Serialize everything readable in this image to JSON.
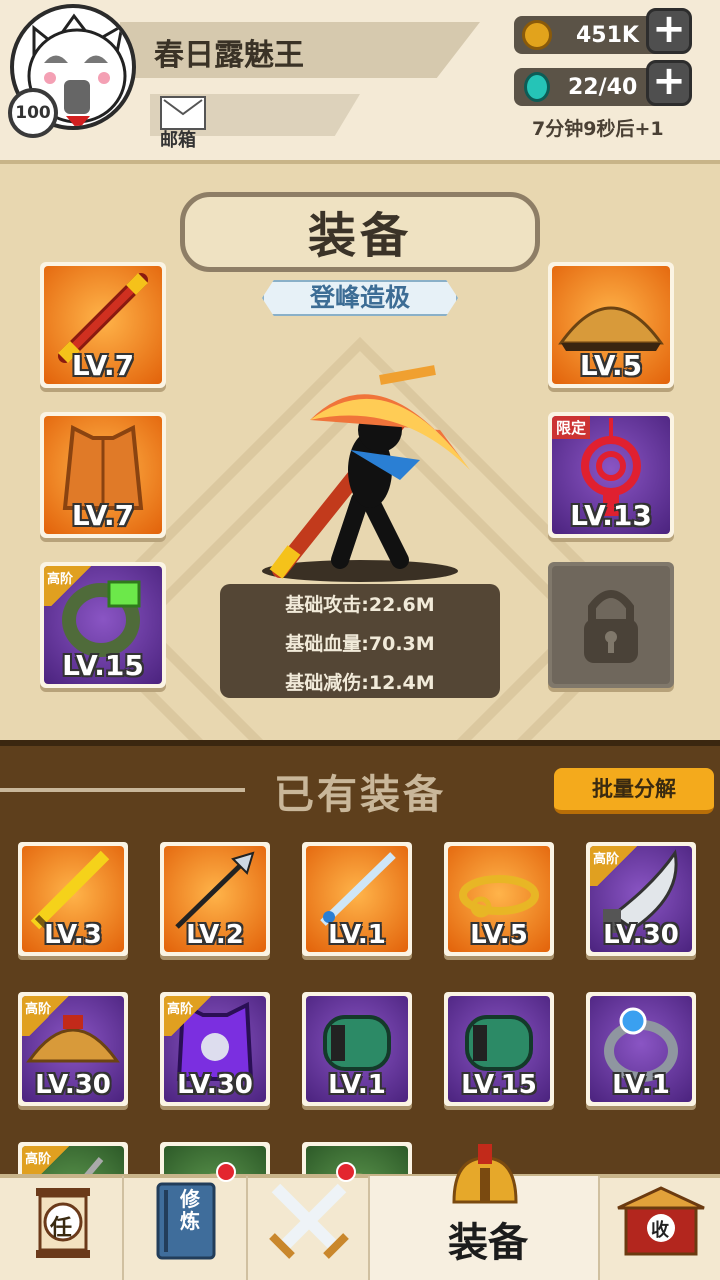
{
  "header": {
    "player_name": "春日露魅王",
    "level": "100",
    "mail_label": "邮箱",
    "coins": "451K",
    "stamina": "22/40",
    "stamina_timer": "7分钟9秒后+1",
    "plus": "+"
  },
  "equip_panel": {
    "title": "装备",
    "tier": "登峰造极",
    "slots_left": [
      {
        "icon": "staff-icon",
        "level": "LV.7",
        "rarity": "orange"
      },
      {
        "icon": "armor-vest-icon",
        "level": "LV.7",
        "rarity": "orange"
      },
      {
        "icon": "jade-ring-icon",
        "level": "LV.15",
        "rarity": "purple",
        "tag": "高阶"
      }
    ],
    "slots_right": [
      {
        "icon": "straw-hat-icon",
        "level": "LV.5",
        "rarity": "orange"
      },
      {
        "icon": "chinese-knot-icon",
        "level": "LV.13",
        "rarity": "purple",
        "tag": "限定"
      },
      {
        "icon": "lock-icon",
        "level": "",
        "rarity": "gray"
      }
    ],
    "stats": [
      "基础攻击:22.6M",
      "基础血量:70.3M",
      "基础减伤:12.4M"
    ]
  },
  "owned": {
    "title": "已有装备",
    "bulk_button": "批量分解",
    "items": [
      {
        "icon": "golden-sword-icon",
        "level": "LV.3",
        "rarity": "orange"
      },
      {
        "icon": "trident-spear-icon",
        "level": "LV.2",
        "rarity": "orange"
      },
      {
        "icon": "blue-sword-icon",
        "level": "LV.1",
        "rarity": "orange"
      },
      {
        "icon": "gold-circlet-icon",
        "level": "LV.5",
        "rarity": "orange"
      },
      {
        "icon": "broad-blade-icon",
        "level": "LV.30",
        "rarity": "purple",
        "tag": "高阶"
      },
      {
        "icon": "straw-hat-icon",
        "level": "LV.30",
        "rarity": "purple",
        "tag": "高阶"
      },
      {
        "icon": "purple-armor-icon",
        "level": "LV.30",
        "rarity": "purple",
        "tag": "高阶"
      },
      {
        "icon": "green-bracer-icon",
        "level": "LV.1",
        "rarity": "purple"
      },
      {
        "icon": "green-bracer-icon",
        "level": "LV.15",
        "rarity": "purple"
      },
      {
        "icon": "silver-ring-icon",
        "level": "LV.1",
        "rarity": "purple"
      },
      {
        "icon": "weapon-icon",
        "level": "",
        "rarity": "green",
        "tag": "高阶"
      },
      {
        "icon": "item-icon",
        "level": "",
        "rarity": "green"
      },
      {
        "icon": "item-icon",
        "level": "",
        "rarity": "green"
      }
    ]
  },
  "nav": {
    "task_label": "任",
    "train_label": "修炼",
    "active_label": "装备",
    "collect_label": "收"
  },
  "colors": {
    "orange_bg": "#e2620a",
    "purple_bg": "#4b237e",
    "badge_red": "#e3262f",
    "gold_button": "#f4aa1c"
  }
}
